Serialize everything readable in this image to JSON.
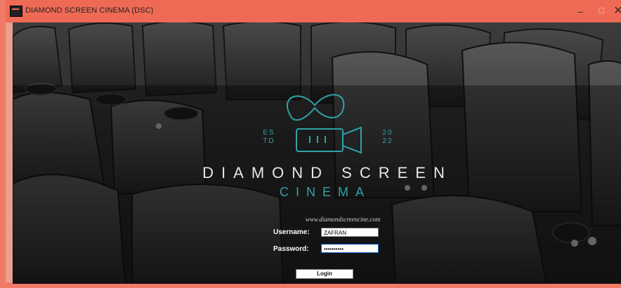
{
  "window": {
    "title": "DIAMOND SCREEN CINEMA (DSC)",
    "minimize_glyph": "–",
    "maximize_glyph": "☐",
    "close_glyph": "✕",
    "accent_color": "#ef6a55"
  },
  "logo": {
    "est_line1": "ES",
    "est_line2": "TD",
    "year_line1": "20",
    "year_line2": "22",
    "brand_line1": "DIAMOND SCREEN",
    "brand_line2": "CINEMA",
    "icon": "film-camera-icon",
    "teal_color": "#2fa3a6"
  },
  "login": {
    "website": "www.diamondscreencine.com",
    "username_label": "Username:",
    "username_value": "ZAFRAN",
    "password_label": "Password:",
    "password_value": "••••••••••",
    "login_button": "Login"
  }
}
